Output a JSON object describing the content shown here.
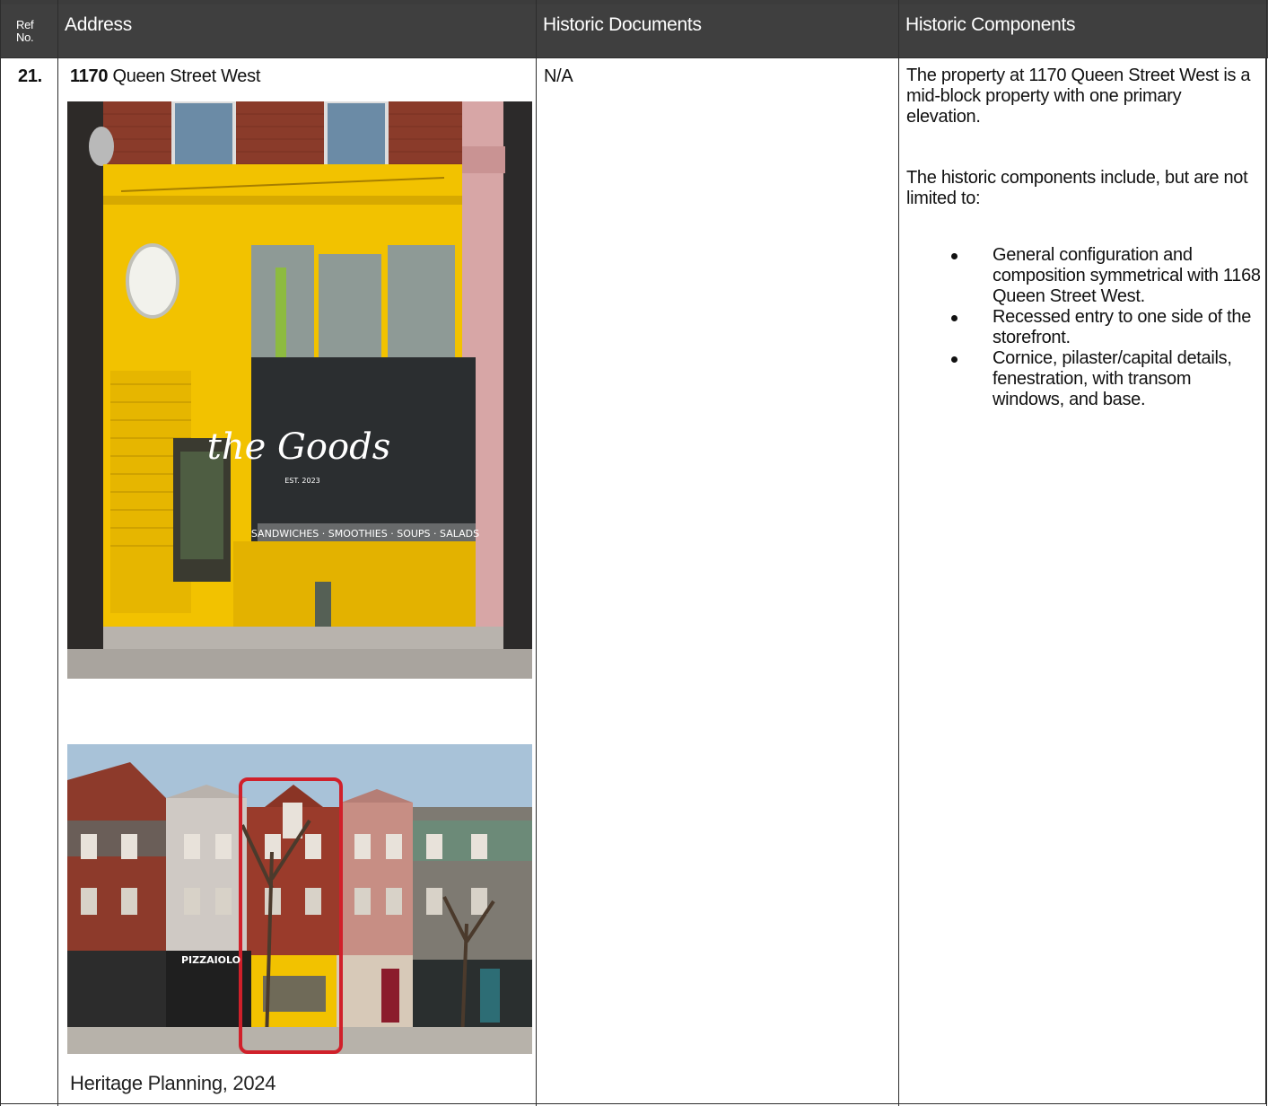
{
  "header": {
    "ref_label": "Ref No.",
    "ref_line1": "Ref",
    "ref_line2": "No.",
    "address": "Address",
    "historic_documents": "Historic Documents",
    "historic_components": "Historic Components"
  },
  "row": {
    "ref_no": "21.",
    "address_number": "1170",
    "address_street": " Queen Street West",
    "historic_documents": "N/A",
    "components_intro": "The property at 1170 Queen Street West is a mid-block property with one primary elevation.",
    "components_lead": "The historic components include, but are not limited to:",
    "components_bullets": [
      "General configuration and composition symmetrical with 1168 Queen Street West.",
      "Recessed entry to one side of the storefront.",
      "Cornice, pilaster/capital details, fenestration, with transom windows, and base."
    ],
    "photo_caption": "Heritage Planning, 2024"
  },
  "photo_storefront": {
    "sign_text": "the Goods",
    "window_band": "SANDWICHES · SMOOTHIES · SOUPS · SALADS",
    "est": "EST. 2023"
  },
  "photo_streetscape": {
    "sign_text": "PIZZAIOLO"
  },
  "colors": {
    "header_bg": "#3f3f3f",
    "storefront_yellow": "#f2c200",
    "highlight_red": "#d0202a"
  }
}
